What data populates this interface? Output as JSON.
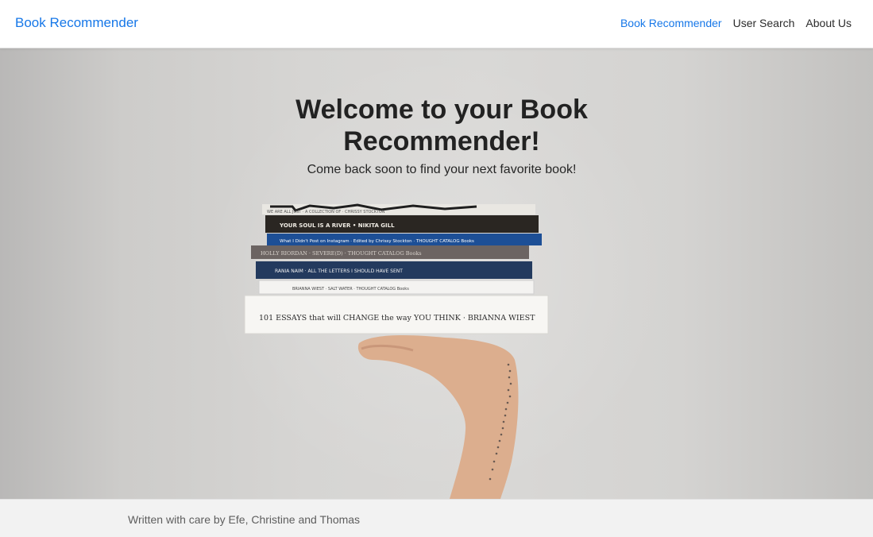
{
  "navbar": {
    "brand": "Book Recommender",
    "links": [
      {
        "label": "Book Recommender",
        "active": true
      },
      {
        "label": "User Search",
        "active": false
      },
      {
        "label": "About Us",
        "active": false
      }
    ]
  },
  "hero": {
    "title": "Welcome to your Book Recommender!",
    "subtitle": "Come back soon to find your next favorite book!",
    "books": [
      {
        "spine_text": "WE ARE ALL JUST · A COLLECTION OF · CHRISSY STOCKTON"
      },
      {
        "spine_text": "YOUR SOUL IS A RIVER • NIKITA GILL"
      },
      {
        "spine_text": "What I Didn't Post on Instagram · Edited by Chrissy Stockton · THOUGHT CATALOG Books"
      },
      {
        "spine_text": "HOLLY RIORDAN · SEVERE(D) · THOUGHT CATALOG Books"
      },
      {
        "spine_text": "RANIA NAIM · ALL THE LETTERS I SHOULD HAVE SENT"
      },
      {
        "spine_text": "BRIANNA WIEST · SALT WATER · THOUGHT CATALOG Books"
      },
      {
        "spine_text": "101 ESSAYS that will CHANGE the way YOU THINK · BRIANNA WIEST"
      }
    ]
  },
  "footer": {
    "text": "Written with care by Efe, Christine and Thomas"
  },
  "colors": {
    "accent": "#1677e8",
    "nav_text": "#2b2b2b",
    "footer_bg": "#f2f2f2"
  }
}
